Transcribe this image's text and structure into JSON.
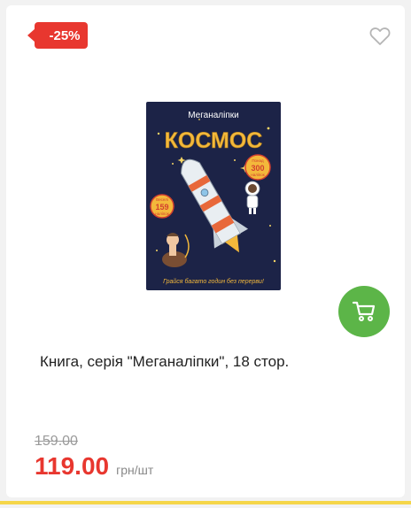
{
  "product": {
    "discount_badge": "-25%",
    "title": "Книга, серія \"Меганаліпки\", 18 стор.",
    "old_price": "159.00",
    "price": "119.00",
    "unit": "грн/шт"
  },
  "cover": {
    "series": "Меганаліпки",
    "headline": "КОСМОС",
    "stickers_top": "Понад",
    "stickers_count": "300",
    "stickers_bottom": "наліпок",
    "fun_top": "Веселі",
    "fun_count": "159",
    "fun_bottom": "наліпок",
    "tagline": "Грайся багато годин без перерви!"
  },
  "icons": {
    "favorite": "heart-outline-icon",
    "cart": "shopping-cart-icon"
  },
  "colors": {
    "accent_red": "#e8372f",
    "cart_green": "#5cb548",
    "cover_bg": "#1c2347",
    "headline_gold": "#f3b83b"
  }
}
